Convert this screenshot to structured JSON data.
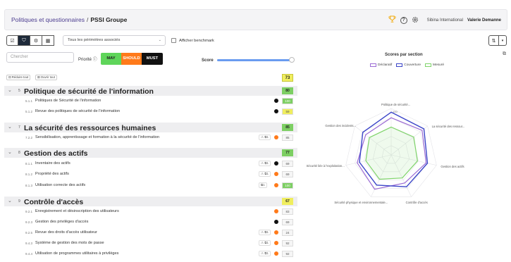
{
  "header": {
    "breadcrumb_parent": "Politiques et questionnaires",
    "breadcrumb_sep": "/",
    "breadcrumb_current": "PSSI Groupe",
    "organization": "Sibina International",
    "user": "Valerie Demanne",
    "icons": [
      "trophy-icon",
      "help-icon",
      "settings-icon"
    ]
  },
  "toolbar": {
    "perimeter_select": "Tous les périmètres associés",
    "benchmark_label": "Afficher benchmark",
    "search_placeholder": "Chercher",
    "priority_label": "Priorité",
    "priority_may": "MAY",
    "priority_should": "SHOULD",
    "priority_must": "MUST",
    "score_label": "Score",
    "score_slider_level": 1.0,
    "reduce_all": "Réduire tout",
    "open_all": "Ouvrir tout",
    "total_score": "73"
  },
  "colors": {
    "accent": "#4b3c8f",
    "may": "#5fd55a",
    "should": "#ff7a1a",
    "must": "#111111",
    "declared": "#9b6bd4",
    "coverage": "#3b45c8",
    "measured": "#7fd46a"
  },
  "sections": [
    {
      "num": "5",
      "title": "Politique de sécurité de l'information",
      "score": "80",
      "color": "#7dcf63",
      "items": [
        {
          "code": "5.1.1",
          "label": "Politiques de Sécurité de l'information",
          "tag": "",
          "dot": "#111111",
          "score": "100"
        },
        {
          "code": "5.1.2",
          "label": "Revue des politiques de sécurité de l'information",
          "tag": "",
          "dot": "#111111",
          "score": "59"
        }
      ]
    },
    {
      "num": "7",
      "title": "La sécurité des ressources humaines",
      "score": "85",
      "color": "#7dcf63",
      "items": [
        {
          "code": "7.2.2",
          "label": "Sensibilisation, apprentissage et formation à la sécurité de l'information",
          "tag": "⚠ ⧉1",
          "dot": "#ff7a1a",
          "score": "85"
        }
      ]
    },
    {
      "num": "8",
      "title": "Gestion des actifs",
      "score": "77",
      "color": "#7dcf63",
      "items": [
        {
          "code": "8.1.1",
          "label": "Inventaire des actifs",
          "tag": "⚠ ⧉1",
          "dot": "#111111",
          "score": "69"
        },
        {
          "code": "8.1.2",
          "label": "Propriété des actifs",
          "tag": "⚠ ⧉1",
          "dot": "#ff7a1a",
          "score": "69"
        },
        {
          "code": "8.1.3",
          "label": "Utilisation correcte des actifs",
          "tag": "⧉1",
          "dot": "#ff7a1a",
          "score": "100"
        }
      ]
    },
    {
      "num": "9",
      "title": "Contrôle d'accès",
      "score": "67",
      "color": "#f0ee5e",
      "items": [
        {
          "code": "9.2.1",
          "label": "Enregistrement et désinscription des utilisateurs",
          "tag": "",
          "dot": "#ff7a1a",
          "score": "83"
        },
        {
          "code": "9.2.3",
          "label": "Gestion des privilèges d'accès",
          "tag": "",
          "dot": "#111111",
          "score": "69"
        },
        {
          "code": "9.2.5",
          "label": "Revue des droits d'accès utilisateur",
          "tag": "⚠ ⧉1",
          "dot": "#ff7a1a",
          "score": "24"
        },
        {
          "code": "9.4.3",
          "label": "Système de gestion des mots de passe",
          "tag": "⚠ ⧉1",
          "dot": "#ff7a1a",
          "score": "92"
        },
        {
          "code": "9.4.4",
          "label": "Utilisation de programmes utilitaires à privilèges",
          "tag": "⚠ ⧉1",
          "dot": "#ff7a1a",
          "score": "92"
        }
      ]
    }
  ],
  "radar": {
    "title": "Scores par section",
    "max_label": "100",
    "legend": [
      "Déclaratif",
      "Couverture",
      "Mesuré"
    ],
    "axes": [
      "Politique de sécurité...",
      "La sécurité des ressour...",
      "Gestion des actifs",
      "Contrôle d'accès",
      "Sécurité physique et environnementale...",
      "Sécurité liée à l'exploitation...",
      "Gestion des incidents..."
    ],
    "series": [
      {
        "name": "Déclaratif",
        "values": [
          80,
          85,
          77,
          67,
          82,
          75,
          70
        ]
      },
      {
        "name": "Couverture",
        "values": [
          92,
          90,
          80,
          76,
          72,
          70,
          78
        ]
      },
      {
        "name": "Mesuré",
        "values": [
          60,
          62,
          58,
          55,
          58,
          56,
          60
        ]
      }
    ]
  }
}
